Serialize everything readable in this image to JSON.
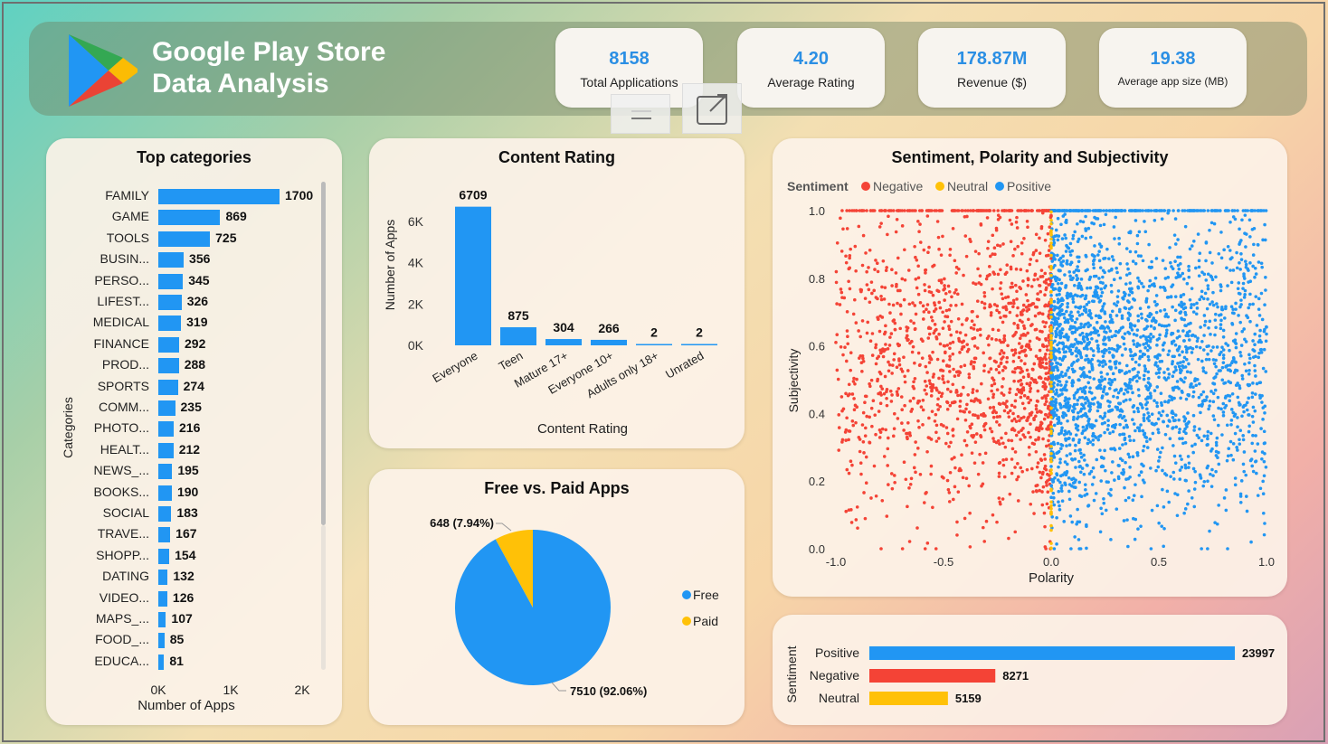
{
  "header": {
    "title_line1": "Google Play Store",
    "title_line2": "Data Analysis",
    "logo_icon": "google-play-logo-icon"
  },
  "kpis": [
    {
      "value": "8158",
      "label": "Total Applications"
    },
    {
      "value": "4.20",
      "label": "Average Rating"
    },
    {
      "value": "178.87M",
      "label": "Revenue ($)"
    },
    {
      "value": "19.38",
      "label": "Average app size (MB)"
    }
  ],
  "colors": {
    "blue": "#2196f3",
    "red": "#f44336",
    "yellow": "#ffc107",
    "kpi_text": "#2b8fe4"
  },
  "chart_data": [
    {
      "type": "bar",
      "orientation": "horizontal",
      "title": "Top categories",
      "xlabel": "Number of Apps",
      "ylabel": "Categories",
      "xticks": [
        "0K",
        "1K",
        "2K"
      ],
      "xlim": [
        0,
        2000
      ],
      "categories": [
        "FAMILY",
        "GAME",
        "TOOLS",
        "BUSIN...",
        "PERSO...",
        "LIFEST...",
        "MEDICAL",
        "FINANCE",
        "PROD...",
        "SPORTS",
        "COMM...",
        "PHOTO...",
        "HEALT...",
        "NEWS_...",
        "BOOKS...",
        "SOCIAL",
        "TRAVE...",
        "SHOPP...",
        "DATING",
        "VIDEO...",
        "MAPS_...",
        "FOOD_...",
        "EDUCA..."
      ],
      "values": [
        1700,
        869,
        725,
        356,
        345,
        326,
        319,
        292,
        288,
        274,
        235,
        216,
        212,
        195,
        190,
        183,
        167,
        154,
        132,
        126,
        107,
        85,
        81
      ]
    },
    {
      "type": "bar",
      "title": "Content Rating",
      "xlabel": "Content Rating",
      "ylabel": "Number of Apps",
      "yticks": [
        "0K",
        "2K",
        "4K",
        "6K"
      ],
      "ylim": [
        0,
        7000
      ],
      "categories": [
        "Everyone",
        "Teen",
        "Mature 17+",
        "Everyone 10+",
        "Adults only 18+",
        "Unrated"
      ],
      "values": [
        6709,
        875,
        304,
        266,
        2,
        2
      ]
    },
    {
      "type": "pie",
      "title": "Free vs. Paid Apps",
      "slices": [
        {
          "name": "Free",
          "value": 7510,
          "label": "7510 (92.06%)"
        },
        {
          "name": "Paid",
          "value": 648,
          "label": "648 (7.94%)"
        }
      ],
      "legend": "right"
    },
    {
      "type": "scatter",
      "title": "Sentiment, Polarity and Subjectivity",
      "xlabel": "Polarity",
      "ylabel": "Subjectivity",
      "legend_title": "Sentiment",
      "legend": [
        "Negative",
        "Neutral",
        "Positive"
      ],
      "xticks": [
        "-1.0",
        "-0.5",
        "0.0",
        "0.5",
        "1.0"
      ],
      "yticks": [
        "0.0",
        "0.2",
        "0.4",
        "0.6",
        "0.8",
        "1.0"
      ],
      "xlim": [
        -1.0,
        1.0
      ],
      "ylim": [
        0.0,
        1.0
      ],
      "series": [
        {
          "name": "Negative",
          "x_range": [
            -1.0,
            0.0
          ],
          "y_range": [
            0.0,
            1.0
          ]
        },
        {
          "name": "Neutral",
          "x_range": [
            0.0,
            0.0
          ],
          "y_range": [
            0.0,
            1.0
          ]
        },
        {
          "name": "Positive",
          "x_range": [
            0.0,
            1.0
          ],
          "y_range": [
            0.0,
            1.0
          ]
        }
      ]
    },
    {
      "type": "bar",
      "orientation": "horizontal",
      "ylabel": "Sentiment",
      "categories": [
        "Positive",
        "Negative",
        "Neutral"
      ],
      "values": [
        23997,
        8271,
        5159
      ]
    }
  ]
}
